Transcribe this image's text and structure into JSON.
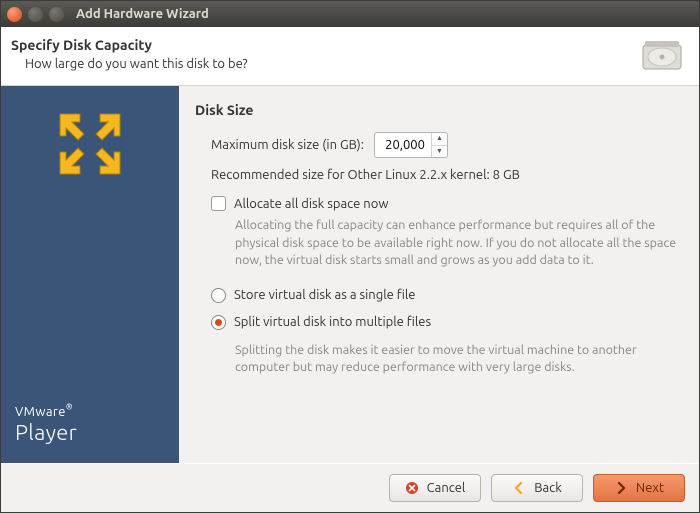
{
  "window": {
    "title": "Add Hardware Wizard"
  },
  "header": {
    "title": "Specify Disk Capacity",
    "subtitle": "How large do you want this disk to be?"
  },
  "sidebar": {
    "brand_small": "VMware",
    "brand_registered": "®",
    "brand_big": "Player"
  },
  "disk": {
    "section_title": "Disk Size",
    "max_label": "Maximum disk size (in GB):",
    "max_value": "20,000",
    "recommended": "Recommended size for Other Linux 2.2.x kernel: 8 GB",
    "allocate_checkbox_label": "Allocate all disk space now",
    "allocate_checkbox_checked": false,
    "allocate_desc": "Allocating the full capacity can enhance performance but requires all of the physical disk space to be available right now. If you do not allocate all the space now, the virtual disk starts small and grows as you add data to it.",
    "radio_single": "Store virtual disk as a single file",
    "radio_split": "Split virtual disk into multiple files",
    "radio_selected": "split",
    "split_desc": "Splitting the disk makes it easier to move the virtual machine to another computer but may reduce performance with very large disks."
  },
  "buttons": {
    "cancel": "Cancel",
    "back": "Back",
    "next": "Next"
  }
}
